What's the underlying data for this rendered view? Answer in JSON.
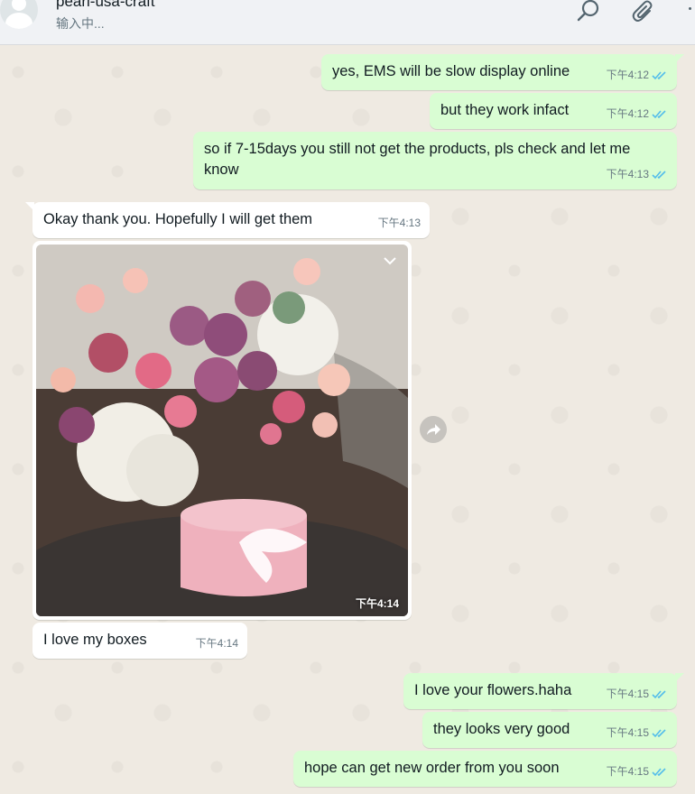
{
  "header": {
    "contact_name": "pearl-usa-craft",
    "status": "输入中..."
  },
  "icons": {
    "search": "search-icon",
    "attach": "paperclip-icon",
    "menu": "more-vertical-icon",
    "forward": "forward-icon",
    "chevron": "chevron-down-icon"
  },
  "colors": {
    "outgoing_bubble": "#d9fdd3",
    "incoming_bubble": "#ffffff",
    "read_ticks": "#53bdeb",
    "chat_bg": "#efeae2"
  },
  "messages": [
    {
      "direction": "out",
      "text": "yes, EMS will be slow display online",
      "time": "下午4:12",
      "read": true
    },
    {
      "direction": "out",
      "text": "but they work infact",
      "time": "下午4:12",
      "read": true
    },
    {
      "direction": "out",
      "text_line1": "so if 7-15days you still not get the products, pls check and let me",
      "text_line2": "know",
      "time": "下午4:13",
      "read": true
    },
    {
      "direction": "in",
      "text": "Okay thank you. Hopefully I will get them",
      "time": "下午4:13"
    },
    {
      "direction": "in",
      "type": "image",
      "image_description": "pink round flower box with roses and hydrangeas",
      "time": "下午4:14"
    },
    {
      "direction": "in",
      "text": "I love my boxes",
      "time": "下午4:14"
    },
    {
      "direction": "out",
      "text": "I love your flowers.haha",
      "time": "下午4:15",
      "read": true
    },
    {
      "direction": "out",
      "text": "they looks very good",
      "time": "下午4:15",
      "read": true
    },
    {
      "direction": "out",
      "text": "hope can get new order from you soon",
      "time": "下午4:15",
      "read": true
    }
  ]
}
